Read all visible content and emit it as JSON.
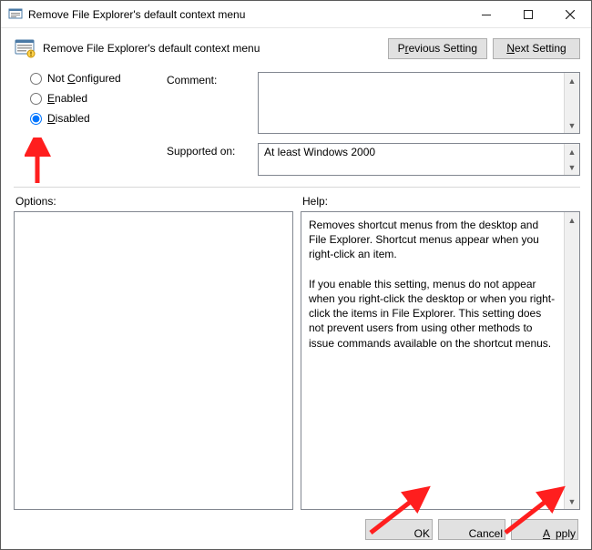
{
  "window": {
    "title": "Remove File Explorer's default context menu"
  },
  "header": {
    "setting_name": "Remove File Explorer's default context menu",
    "prev_pre": "P",
    "prev_u": "r",
    "prev_post": "evious Setting",
    "next_pre": "",
    "next_u": "N",
    "next_post": "ext Setting"
  },
  "radios": {
    "notconf_pre": "Not ",
    "notconf_u": "C",
    "notconf_post": "onfigured",
    "enabled_pre": "",
    "enabled_u": "E",
    "enabled_post": "nabled",
    "disabled_pre": "",
    "disabled_u": "D",
    "disabled_post": "isabled",
    "selected": "disabled"
  },
  "fields": {
    "comment_label": "Comment:",
    "comment_value": "",
    "supported_label": "Supported on:",
    "supported_value": "At least Windows 2000"
  },
  "labels": {
    "options": "Options:",
    "help": "Help:"
  },
  "help_text": "Removes shortcut menus from the desktop and File Explorer. Shortcut menus appear when you right-click an item.\n\nIf you enable this setting, menus do not appear when you right-click the desktop or when you right-click the items in File Explorer. This setting does not prevent users from using other methods to issue commands available on the shortcut menus.",
  "footer": {
    "ok": "OK",
    "cancel": "Cancel",
    "apply_pre": "",
    "apply_u": "A",
    "apply_post": "pply"
  },
  "icons": {
    "app": "policy-icon",
    "minimize": "minimize-icon",
    "maximize": "maximize-icon",
    "close": "close-icon"
  }
}
